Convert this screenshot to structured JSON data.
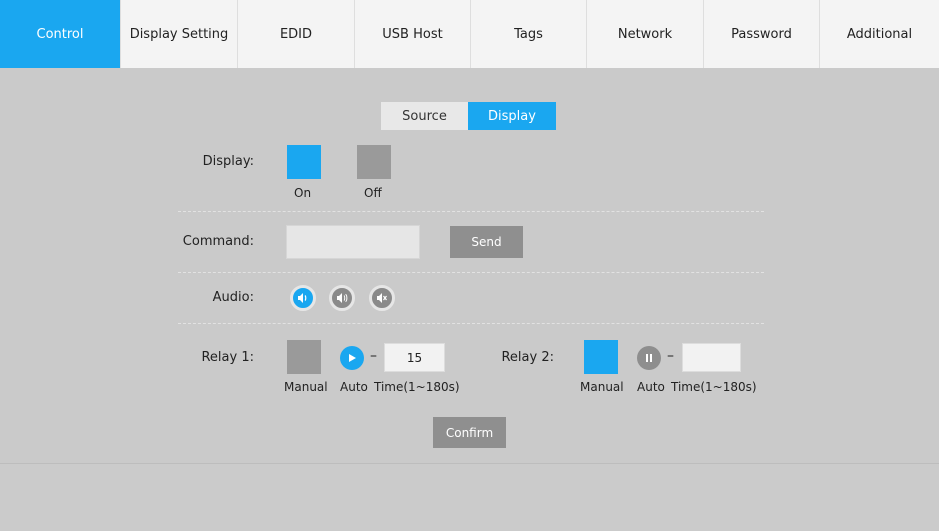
{
  "tabs": [
    {
      "label": "Control",
      "active": true
    },
    {
      "label": "Display Setting",
      "active": false
    },
    {
      "label": "EDID",
      "active": false
    },
    {
      "label": "USB Host",
      "active": false
    },
    {
      "label": "Tags",
      "active": false
    },
    {
      "label": "Network",
      "active": false
    },
    {
      "label": "Password",
      "active": false
    },
    {
      "label": "Additional",
      "active": false
    }
  ],
  "toggle": {
    "source": "Source",
    "display": "Display",
    "selected": "Display"
  },
  "display_row": {
    "label": "Display:",
    "on": "On",
    "off": "Off",
    "selected": "On"
  },
  "command_row": {
    "label": "Command:",
    "value": "",
    "send": "Send"
  },
  "audio_row": {
    "label": "Audio:",
    "icons": [
      "volume-on-icon",
      "volume-icon",
      "mute-icon"
    ],
    "selected": "volume-on-icon"
  },
  "relay1": {
    "label": "Relay 1:",
    "manual": "Manual",
    "auto": "Auto",
    "time_label": "Time(1~180s)",
    "time_value": "15",
    "mode": "Auto"
  },
  "relay2": {
    "label": "Relay 2:",
    "manual": "Manual",
    "auto": "Auto",
    "time_label": "Time(1~180s)",
    "time_value": "",
    "mode": "Manual"
  },
  "confirm": "Confirm",
  "colors": {
    "accent": "#1aa7f0",
    "gray_button": "#8f8f8f",
    "panel_bg": "#cacaca"
  }
}
